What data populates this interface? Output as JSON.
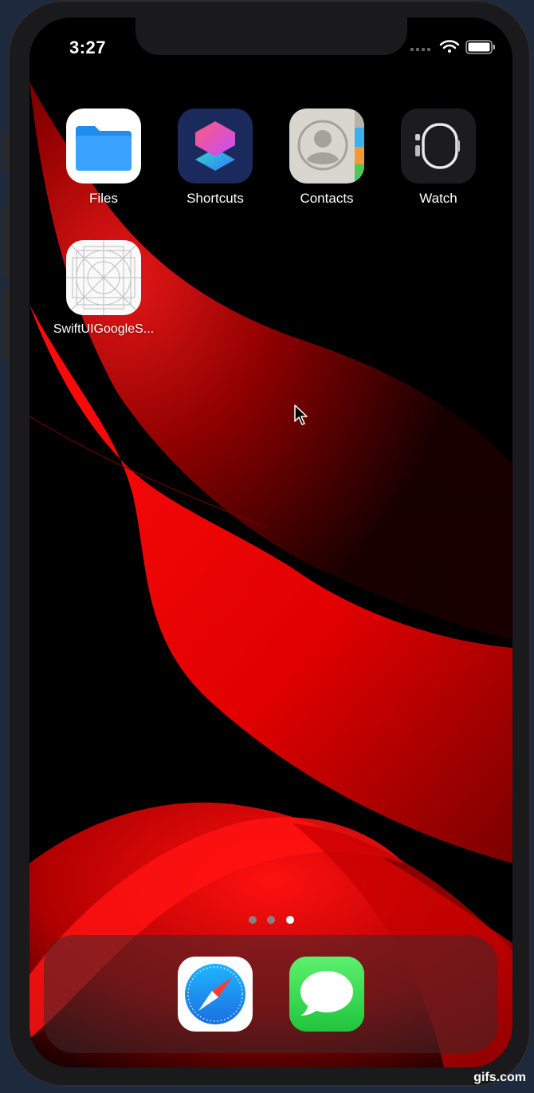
{
  "status_bar": {
    "time": "3:27"
  },
  "home_apps": [
    {
      "label": "Files",
      "icon": "files-icon"
    },
    {
      "label": "Shortcuts",
      "icon": "shortcuts-icon"
    },
    {
      "label": "Contacts",
      "icon": "contacts-icon"
    },
    {
      "label": "Watch",
      "icon": "watch-icon"
    },
    {
      "label": "SwiftUIGoogleS...",
      "icon": "app-placeholder-icon"
    }
  ],
  "dock_apps": [
    {
      "label": "Safari",
      "icon": "safari-icon"
    },
    {
      "label": "Messages",
      "icon": "messages-icon"
    }
  ],
  "page_indicator": {
    "pages": 3,
    "current": 3
  },
  "watermark": "gifs.com",
  "colors": {
    "wallpaper_red": "#e00000",
    "bezel": "#1a1a1c",
    "background": "#1d2a3e"
  }
}
